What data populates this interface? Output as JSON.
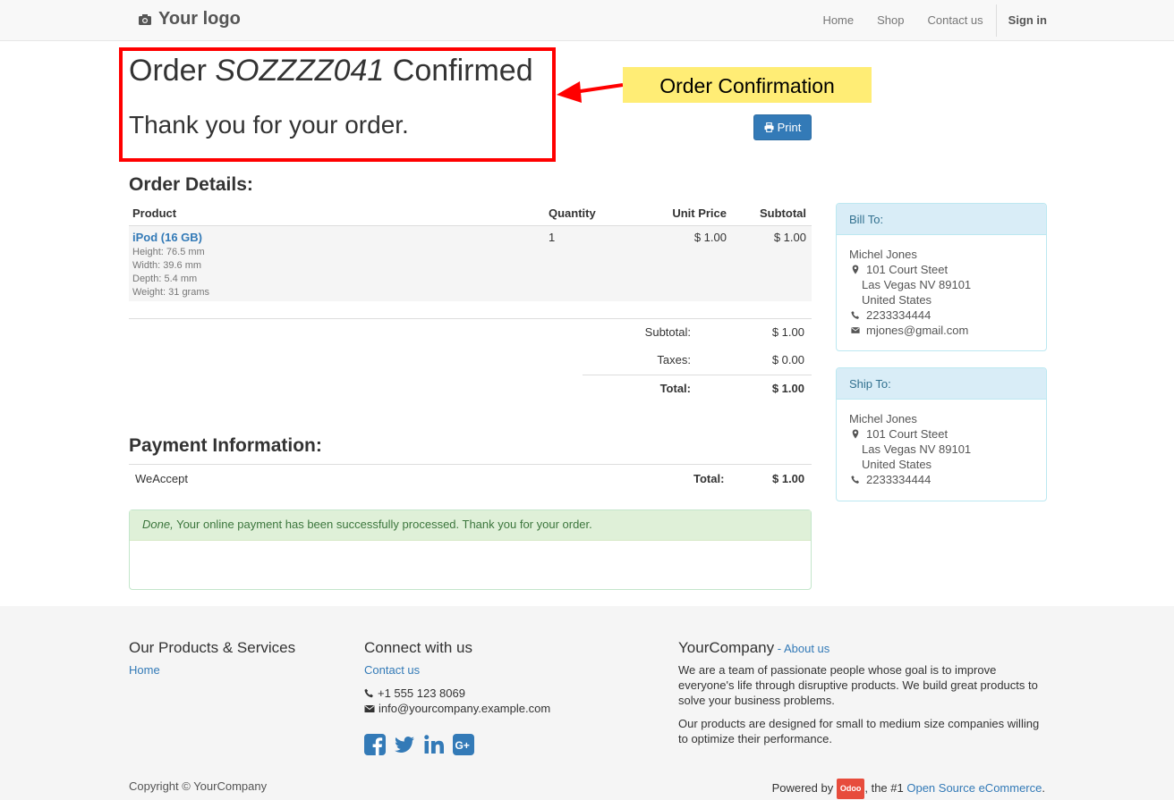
{
  "navbar": {
    "logo_text": "Your logo",
    "items": [
      "Home",
      "Shop",
      "Contact us"
    ],
    "signin": "Sign in"
  },
  "header": {
    "order_prefix": "Order",
    "order_number": "SOZZZZ041",
    "order_suffix": "Confirmed",
    "thank_you": "Thank you for your order.",
    "annotation_label": "Order Confirmation",
    "print_label": "Print"
  },
  "order_details": {
    "title": "Order Details:",
    "columns": [
      "Product",
      "Quantity",
      "Unit Price",
      "Subtotal"
    ],
    "product": {
      "name": "iPod (16 GB)",
      "attributes": [
        "Height: 76.5 mm",
        "Width: 39.6 mm",
        "Depth: 5.4 mm",
        "Weight: 31 grams"
      ],
      "quantity": "1",
      "unit_price": "$ 1.00",
      "subtotal": "$ 1.00"
    },
    "totals": {
      "subtotal_label": "Subtotal:",
      "subtotal_value": "$ 1.00",
      "taxes_label": "Taxes:",
      "taxes_value": "$ 0.00",
      "total_label": "Total:",
      "total_value": "$ 1.00"
    }
  },
  "bill_to": {
    "title": "Bill To:",
    "name": "Michel Jones",
    "street": "101 Court Steet",
    "city": "Las Vegas NV 89101",
    "country": "United States",
    "phone": "2233334444",
    "email": "mjones@gmail.com"
  },
  "ship_to": {
    "title": "Ship To:",
    "name": "Michel Jones",
    "street": "101 Court Steet",
    "city": "Las Vegas NV 89101",
    "country": "United States",
    "phone": "2233334444"
  },
  "payment": {
    "title": "Payment Information:",
    "method": "WeAccept",
    "total_label": "Total:",
    "total_value": "$ 1.00",
    "status_done": "Done,",
    "status_message": "Your online payment has been successfully processed. Thank you for your order."
  },
  "footer": {
    "products_title": "Our Products & Services",
    "home_link": "Home",
    "connect_title": "Connect with us",
    "contact_link": "Contact us",
    "phone": "+1 555 123 8069",
    "email": "info@yourcompany.example.com",
    "company_name": "YourCompany",
    "about_link": "About us",
    "about_sep": " - ",
    "desc1": "We are a team of passionate people whose goal is to improve everyone's life through disruptive products. We build great products to solve your business problems.",
    "desc2": "Our products are designed for small to medium size companies willing to optimize their performance.",
    "copyright": "Copyright © YourCompany",
    "powered_by": "Powered by",
    "odoo_badge": "Odoo",
    "powered_mid": ", the #1",
    "powered_link": "Open Source eCommerce",
    "powered_end": ".",
    "social_icons": [
      "facebook-icon",
      "twitter-icon",
      "linkedin-icon",
      "google-plus-icon"
    ]
  },
  "colors": {
    "link": "#337ab7",
    "annotation_red": "#ff0000",
    "annotation_yellow": "#ffed75",
    "panel_header": "#d9edf7",
    "alert_success": "#dff0d8"
  }
}
